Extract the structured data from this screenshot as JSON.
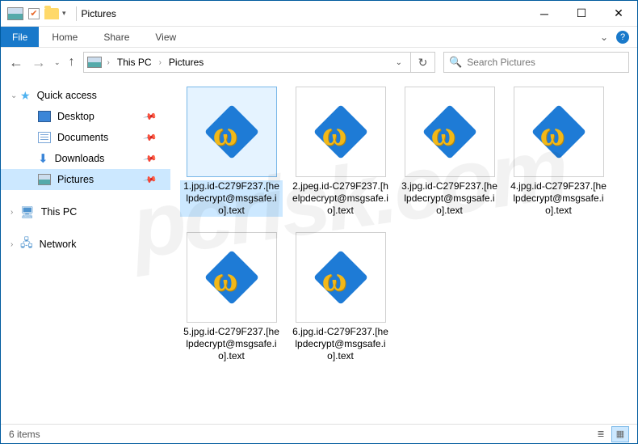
{
  "title_bar": {
    "title": "Pictures"
  },
  "ribbon": {
    "file": "File",
    "tabs": [
      "Home",
      "Share",
      "View"
    ]
  },
  "nav": {
    "breadcrumb": [
      "This PC",
      "Pictures"
    ],
    "search_placeholder": "Search Pictures"
  },
  "sidebar": {
    "quick_access": "Quick access",
    "items": [
      {
        "label": "Desktop",
        "pinned": true
      },
      {
        "label": "Documents",
        "pinned": true
      },
      {
        "label": "Downloads",
        "pinned": true
      },
      {
        "label": "Pictures",
        "pinned": true,
        "selected": true
      }
    ],
    "this_pc": "This PC",
    "network": "Network"
  },
  "files": [
    {
      "name": "1.jpg.id-C279F237.[helpdecrypt@msgsafe.io].text",
      "selected": true
    },
    {
      "name": "2.jpeg.id-C279F237.[helpdecrypt@msgsafe.io].text"
    },
    {
      "name": "3.jpg.id-C279F237.[helpdecrypt@msgsafe.io].text"
    },
    {
      "name": "4.jpg.id-C279F237.[helpdecrypt@msgsafe.io].text"
    },
    {
      "name": "5.jpg.id-C279F237.[helpdecrypt@msgsafe.io].text"
    },
    {
      "name": "6.jpg.id-C279F237.[helpdecrypt@msgsafe.io].text"
    }
  ],
  "status": {
    "count": "6 items"
  },
  "watermark": "pcrisk.com"
}
